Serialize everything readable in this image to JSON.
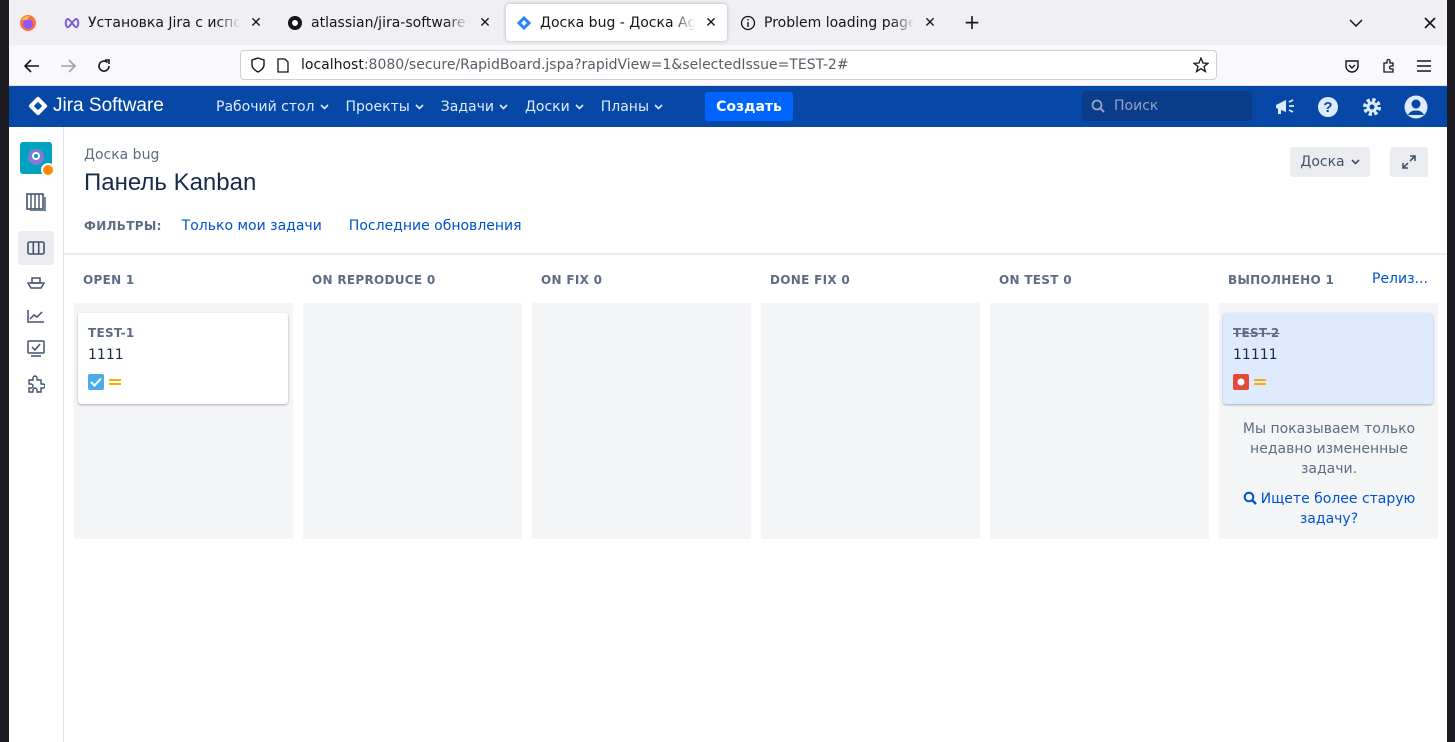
{
  "browser": {
    "tabs": [
      {
        "title": "Установка Jira с использованием",
        "icon": "extension-infinity-icon"
      },
      {
        "title": "atlassian/jira-software - Docker",
        "icon": "docker-icon"
      },
      {
        "title": "Доска bug - Доска Agile - Jira",
        "icon": "jira-icon"
      },
      {
        "title": "Problem loading page",
        "icon": "info-icon"
      }
    ],
    "url_host": "localhost",
    "url_rest": ":8080/secure/RapidBoard.jspa?rapidView=1&selectedIssue=TEST-2#"
  },
  "jira": {
    "logo_text": "Jira Software",
    "nav": [
      "Рабочий стол",
      "Проекты",
      "Задачи",
      "Доски",
      "Планы"
    ],
    "create_label": "Создать",
    "search_placeholder": "Поиск",
    "accent": "#0747a6",
    "create_color": "#0065ff"
  },
  "board": {
    "breadcrumb": "Доска bug",
    "title": "Панель Kanban",
    "board_button": "Доска",
    "filters_label": "ФИЛЬТРЫ:",
    "filters": [
      "Только мои задачи",
      "Последние обновления"
    ],
    "release_link": "Релиз...",
    "columns": [
      {
        "name": "OPEN",
        "count": "1"
      },
      {
        "name": "ON REPRODUCE",
        "count": "0"
      },
      {
        "name": "ON FIX",
        "count": "0"
      },
      {
        "name": "DONE FIX",
        "count": "0"
      },
      {
        "name": "ON TEST",
        "count": "0"
      },
      {
        "name": "ВЫПОЛНЕНО",
        "count": "1"
      }
    ],
    "cards": [
      {
        "key": "TEST-1",
        "summary": "1111",
        "type": "task",
        "priority": "medium",
        "column": "OPEN"
      },
      {
        "key": "TEST-2",
        "summary": "11111",
        "type": "bug",
        "priority": "medium",
        "column": "ВЫПОЛНЕНО",
        "selected": true,
        "done": true
      }
    ],
    "done_note": "Мы показываем только недавно измененные задачи.",
    "older_link": "Ищете более старую задачу?"
  }
}
